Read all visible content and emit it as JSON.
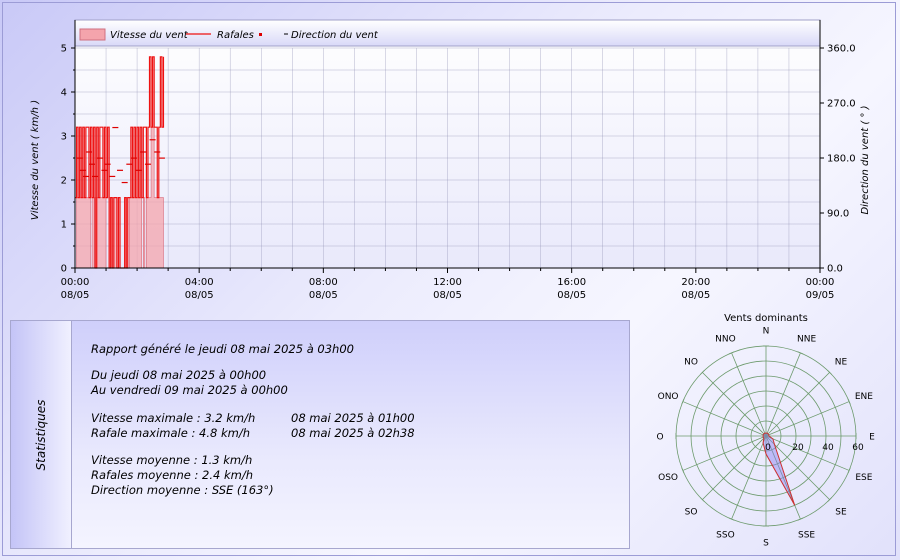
{
  "chart_data": [
    {
      "type": "area",
      "legend": [
        "Vitesse du vent",
        "Rafales",
        "Direction du vent"
      ],
      "legend_position": "top",
      "grid": true,
      "ylabel": "Vitesse du vent ( km/h )",
      "ylabel_right": "Direction du vent ( ° )",
      "xlim_hours": [
        0,
        24
      ],
      "ylim": [
        0,
        5
      ],
      "ylim_right": [
        0,
        360
      ],
      "y_ticks": [
        "0",
        "1",
        "2",
        "3",
        "4",
        "5"
      ],
      "y_right_ticks": [
        "0.0",
        "90.0",
        "180.0",
        "270.0",
        "360.0"
      ],
      "x_ticks": [
        {
          "time": "00:00",
          "date": "08/05"
        },
        {
          "time": "04:00",
          "date": "08/05"
        },
        {
          "time": "08:00",
          "date": "08/05"
        },
        {
          "time": "12:00",
          "date": "08/05"
        },
        {
          "time": "16:00",
          "date": "08/05"
        },
        {
          "time": "20:00",
          "date": "08/05"
        },
        {
          "time": "00:00",
          "date": "09/05"
        }
      ],
      "series": [
        {
          "name": "Vitesse du vent",
          "x_hours": [
            0.0,
            0.05,
            0.1,
            0.45,
            0.5,
            0.55,
            0.62,
            0.65,
            0.7,
            0.95,
            1.0,
            1.1,
            1.2,
            1.25,
            1.35,
            1.5,
            1.6,
            1.7,
            1.75,
            2.1,
            2.15,
            2.2,
            2.25,
            2.3,
            2.4,
            2.45,
            2.55,
            2.7,
            2.8,
            2.85
          ],
          "values": [
            0.0,
            1.6,
            1.6,
            1.6,
            0.0,
            1.6,
            0.0,
            1.6,
            1.6,
            1.6,
            0.0,
            1.6,
            0.0,
            1.6,
            0.0,
            0.0,
            1.6,
            0.0,
            1.6,
            1.6,
            0.0,
            1.6,
            0.0,
            1.6,
            1.6,
            3.2,
            1.6,
            1.6,
            1.6,
            0.0
          ]
        },
        {
          "name": "Rafales",
          "x_hours": [
            0.0,
            0.05,
            0.1,
            0.15,
            0.2,
            0.25,
            0.3,
            0.35,
            0.4,
            0.45,
            0.5,
            0.55,
            0.6,
            0.65,
            0.7,
            0.75,
            0.8,
            0.85,
            0.9,
            0.95,
            1.0,
            1.05,
            1.1,
            1.15,
            1.2,
            1.25,
            1.3,
            1.35,
            1.4,
            1.45,
            1.5,
            1.55,
            1.6,
            1.65,
            1.7,
            1.75,
            1.8,
            1.85,
            1.9,
            1.95,
            2.0,
            2.05,
            2.1,
            2.15,
            2.2,
            2.25,
            2.3,
            2.35,
            2.4,
            2.45,
            2.5,
            2.55,
            2.6,
            2.65,
            2.7,
            2.75,
            2.8,
            2.85
          ],
          "values": [
            1.6,
            3.2,
            1.6,
            3.2,
            1.6,
            3.2,
            1.6,
            3.2,
            3.2,
            1.6,
            3.2,
            1.6,
            3.2,
            0.0,
            3.2,
            1.6,
            3.2,
            3.2,
            1.6,
            3.2,
            1.6,
            3.2,
            0.0,
            1.6,
            0.0,
            1.6,
            1.6,
            0.0,
            1.6,
            0.0,
            0.0,
            0.0,
            1.6,
            0.0,
            1.6,
            1.6,
            3.2,
            1.6,
            3.2,
            1.6,
            3.2,
            1.6,
            3.2,
            1.6,
            3.2,
            3.2,
            1.6,
            3.2,
            4.8,
            3.2,
            4.8,
            3.2,
            3.2,
            1.6,
            3.2,
            4.8,
            3.2,
            4.8
          ]
        },
        {
          "name": "Direction du vent",
          "x_hours": [
            0.15,
            0.25,
            0.35,
            0.45,
            0.55,
            0.65,
            0.8,
            0.95,
            1.05,
            1.2,
            1.3,
            1.45,
            1.6,
            1.75,
            1.9,
            2.05,
            2.2,
            2.35,
            2.5,
            2.65,
            2.8
          ],
          "values": [
            180,
            160,
            150,
            190,
            170,
            150,
            180,
            160,
            170,
            150,
            230,
            160,
            140,
            170,
            180,
            160,
            190,
            170,
            210,
            190,
            180
          ]
        }
      ]
    },
    {
      "type": "radar",
      "title": "Vents dominants",
      "directions": [
        "N",
        "NNE",
        "NE",
        "ENE",
        "E",
        "ESE",
        "SE",
        "SSE",
        "S",
        "SSO",
        "SO",
        "OSO",
        "O",
        "ONO",
        "NO",
        "NNO"
      ],
      "radial_ticks": [
        "0",
        "20",
        "40",
        "60"
      ],
      "rmax": 60,
      "series": [
        {
          "name": "",
          "values": [
            2,
            2,
            2,
            2,
            2,
            5,
            8,
            50,
            12,
            5,
            2,
            2,
            2,
            2,
            2,
            2
          ],
          "color": "#7070ff"
        }
      ]
    }
  ],
  "stats": {
    "side_label": "Statistiques",
    "report": "Rapport généré le jeudi 08 mai 2025 à 03h00",
    "from": "Du jeudi 08 mai 2025 à 00h00",
    "to": "Au vendredi 09 mai 2025 à 00h00",
    "max_speed": "Vitesse maximale : 3.2 km/h",
    "max_speed_date": "08 mai 2025 à 01h00",
    "max_gust": "Rafale maximale : 4.8 km/h",
    "max_gust_date": "08 mai 2025 à 02h38",
    "avg_speed": "Vitesse moyenne : 1.3 km/h",
    "avg_gust": "Rafales moyenne : 2.4 km/h",
    "avg_dir": "Direction moyenne : SSE (163°)"
  },
  "colors": {
    "speed_fill": "#f4a4ac",
    "gust_line": "#ee1111",
    "direction_marker": "#dd0000",
    "rose_fill": "#8a7ff0",
    "grid": "#8a8ab0"
  }
}
